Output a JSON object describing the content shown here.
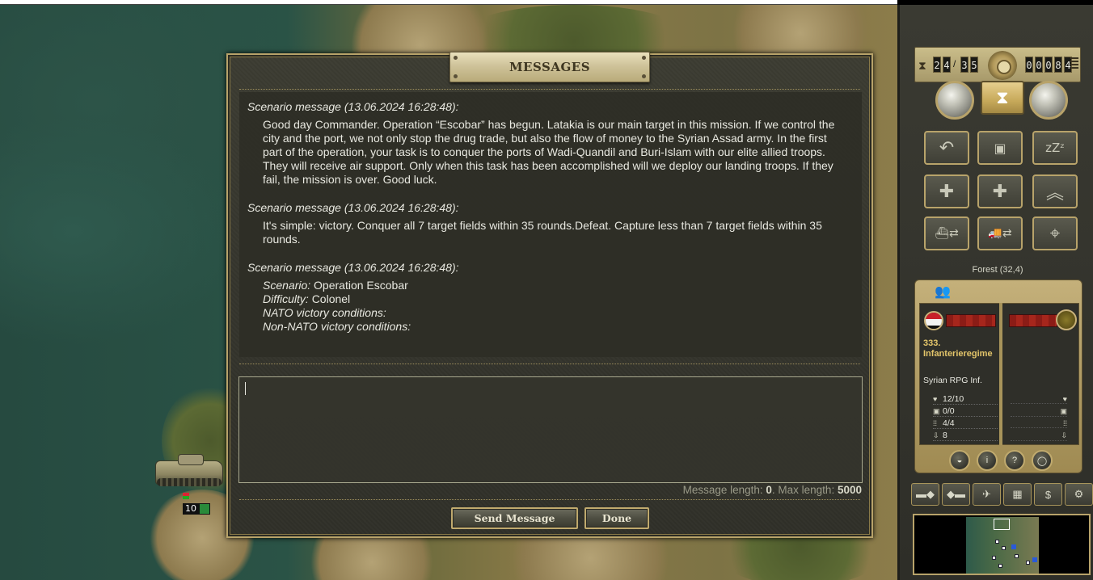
{
  "dialog": {
    "title": "MESSAGES",
    "messages": [
      {
        "header": "Scenario message (13.06.2024 16:28:48):",
        "body": "Good day Commander. Operation “Escobar” has begun. Latakia is our main target in this mission. If we control the city and the port, we not only stop the drug trade, but also the flow of money to the Syrian Assad army. In the first part of the operation, your task is to conquer the ports of Wadi-Quandil and Buri-Islam with our elite allied troops. They will receive air support. Only when this task has been accomplished will we deploy our landing troops. If they fail, the mission is over. Good luck."
      },
      {
        "header": "Scenario message (13.06.2024 16:28:48):",
        "body": "It's simple: victory. Conquer all 7 target fields within 35 rounds.Defeat. Capture less than 7 target fields within 35 rounds."
      },
      {
        "header": "Scenario message (13.06.2024 16:28:48):",
        "info": {
          "scenario_key": "Scenario:",
          "scenario_val": "Operation Escobar",
          "difficulty_key": "Difficulty:",
          "difficulty_val": "Colonel",
          "nato_key": "NATO victory conditions:",
          "non_nato_key": "Non-NATO victory conditions:"
        }
      }
    ],
    "input_value": "",
    "length_label": "Message length: ",
    "length_value": "0",
    "max_label": ". Max length: ",
    "max_value": "5000",
    "send_label": "Send Message",
    "done_label": "Done"
  },
  "panel": {
    "round_current": [
      "2",
      "4"
    ],
    "round_separator": "/",
    "round_total": [
      "3",
      "5"
    ],
    "counter": [
      "0",
      "0",
      "0",
      "8",
      "4"
    ],
    "hex_label": "Forest (32,4)",
    "unit": {
      "name": "333. Infanterieregime",
      "type": "Syrian RPG Inf.",
      "strength": "12/10",
      "fuel": "0/0",
      "ammo": "4/4",
      "movement": "8"
    }
  },
  "map": {
    "unit_strength": "10"
  },
  "colors": {
    "accent": "#b8a36a",
    "dialog_bg": "#35352d",
    "unit_name": "#e3c56a"
  }
}
